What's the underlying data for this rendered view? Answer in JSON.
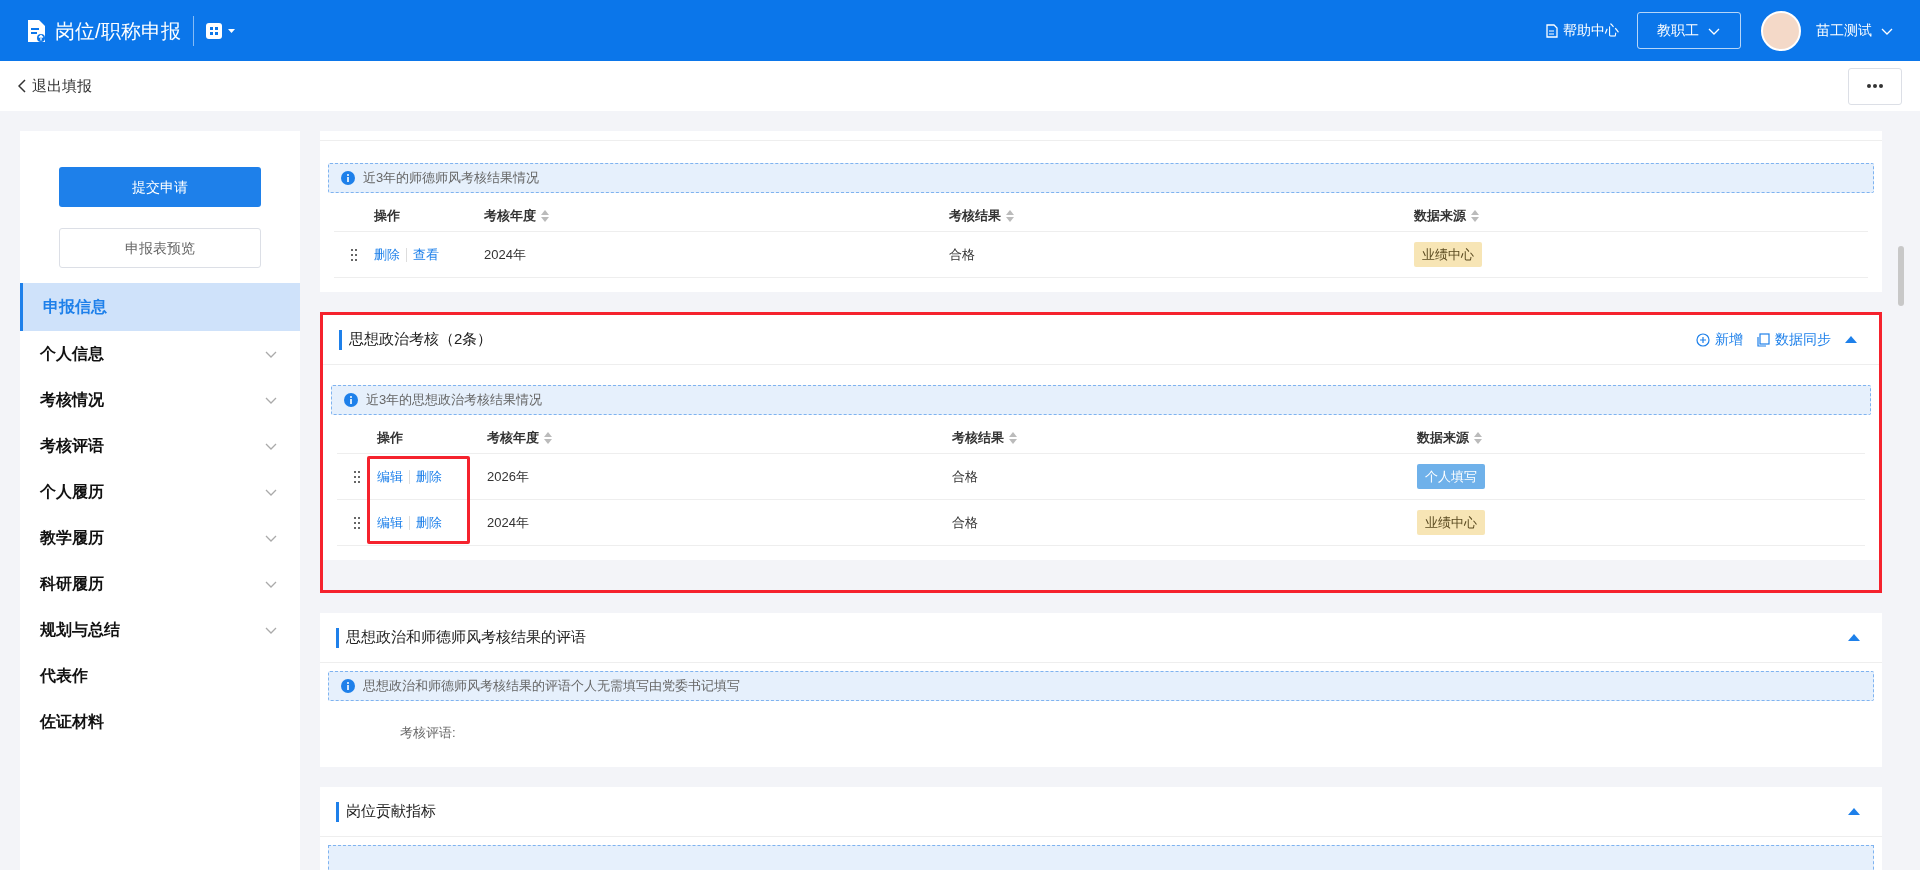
{
  "header": {
    "app_title": "岗位/职称申报",
    "help": "帮助中心",
    "role": "教职工",
    "user": "苗工测试"
  },
  "subheader": {
    "back": "退出填报"
  },
  "sidebar": {
    "submit": "提交申请",
    "preview": "申报表预览",
    "items": [
      {
        "label": "申报信息",
        "selected": true,
        "expandable": false
      },
      {
        "label": "个人信息",
        "selected": false,
        "expandable": true
      },
      {
        "label": "考核情况",
        "selected": false,
        "expandable": true
      },
      {
        "label": "考核评语",
        "selected": false,
        "expandable": true
      },
      {
        "label": "个人履历",
        "selected": false,
        "expandable": true
      },
      {
        "label": "教学履历",
        "selected": false,
        "expandable": true
      },
      {
        "label": "科研履历",
        "selected": false,
        "expandable": true
      },
      {
        "label": "规划与总结",
        "selected": false,
        "expandable": true
      },
      {
        "label": "代表作",
        "selected": false,
        "expandable": false
      },
      {
        "label": "佐证材料",
        "selected": false,
        "expandable": false
      }
    ]
  },
  "sections": [
    {
      "kind": "table",
      "highlighted": false,
      "notice": "近3年的师德师风考核结果情况",
      "columns": [
        "操作",
        "考核年度",
        "考核结果",
        "数据来源"
      ],
      "rows": [
        {
          "actions": [
            "删除",
            "查看"
          ],
          "year": "2024年",
          "result": "合格",
          "source": "业绩中心",
          "color": "#f7e5b5"
        }
      ]
    },
    {
      "kind": "table",
      "title": "思想政治考核（2条）",
      "highlighted": true,
      "actions": [
        "新增",
        "数据同步"
      ],
      "notice": "近3年的思想政治考核结果情况",
      "columns": [
        "操作",
        "考核年度",
        "考核结果",
        "数据来源"
      ],
      "rows": [
        {
          "actions": [
            "编辑",
            "删除"
          ],
          "year": "2026年",
          "result": "合格",
          "source": "个人填写",
          "color": "#6fb1ea"
        },
        {
          "actions": [
            "编辑",
            "删除"
          ],
          "year": "2024年",
          "result": "合格",
          "source": "业绩中心",
          "color": "#f7e5b5"
        }
      ]
    },
    {
      "kind": "comment",
      "title": "思想政治和师德师风考核结果的评语",
      "highlighted": false,
      "notice": "思想政治和师德师风考核结果的评语个人无需填写由党委书记填写",
      "field_label": "考核评语:"
    },
    {
      "kind": "partial",
      "title": "岗位贡献指标",
      "highlighted": false
    }
  ]
}
